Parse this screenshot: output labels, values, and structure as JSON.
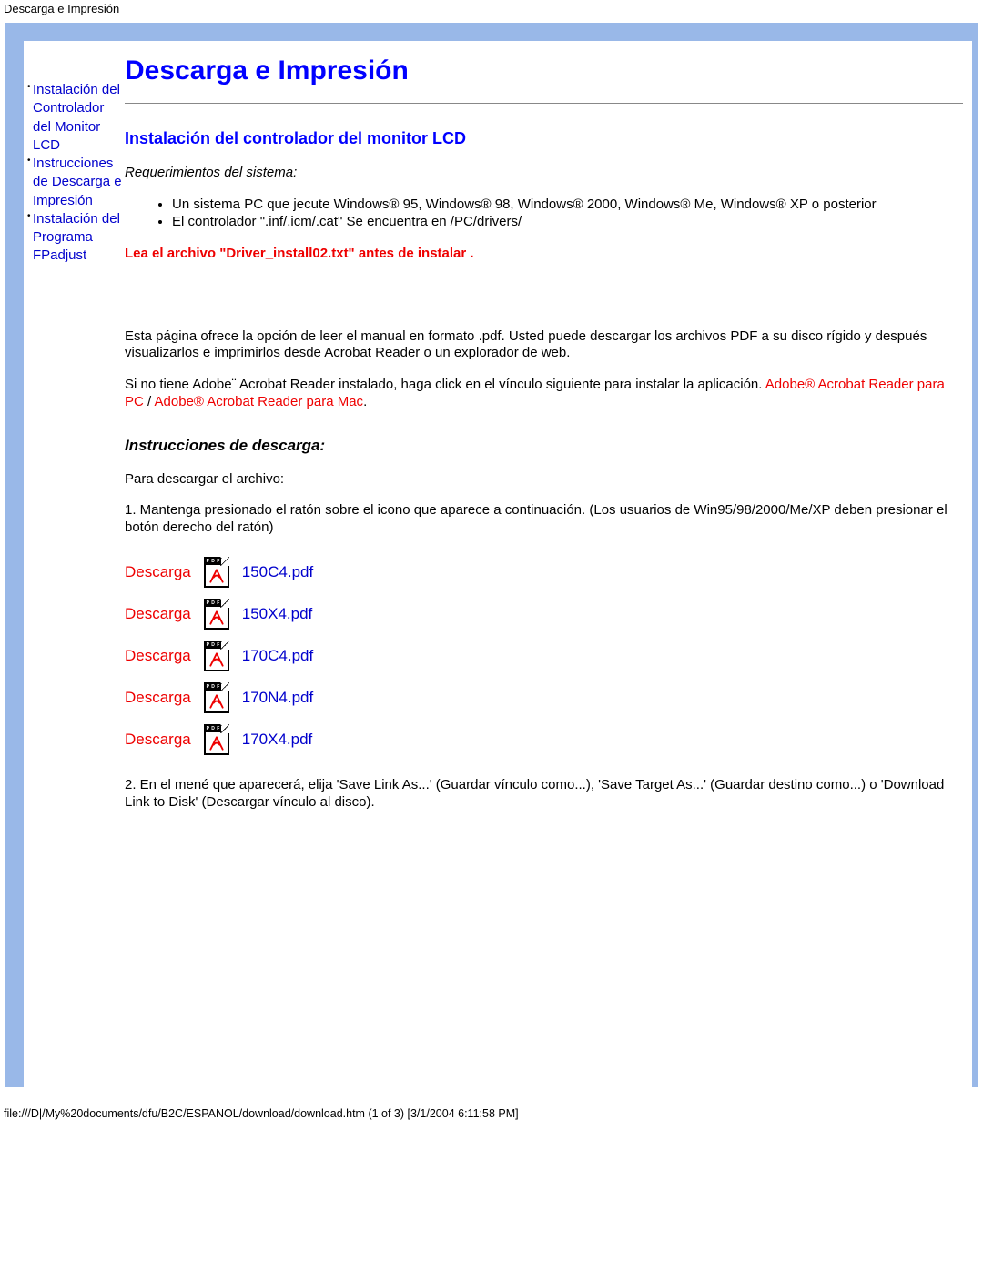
{
  "header": {
    "text": "Descarga e Impresión"
  },
  "sidebar": {
    "items": [
      {
        "label": "Instalación del Controlador del Monitor LCD"
      },
      {
        "label": "Instrucciones de Descarga e Impresión"
      },
      {
        "label": "Instalación del Programa FPadjust"
      }
    ]
  },
  "main": {
    "title": "Descarga e Impresión",
    "section1_title": "Instalación del controlador del monitor LCD",
    "sysreq_label": "Requerimientos del sistema:",
    "sysreq_items": [
      "Un sistema PC que jecute Windows® 95, Windows® 98, Windows® 2000, Windows® Me, Windows® XP o posterior",
      "El controlador \".inf/.icm/.cat\" Se encuentra en /PC/drivers/"
    ],
    "read_file_warning": "Lea el archivo \"Driver_install02.txt\" antes de instalar .",
    "intro_para": "Esta página ofrece la opción de leer el manual en formato .pdf. Usted puede descargar los archivos PDF a su disco rígido y después visualizarlos e imprimirlos desde Acrobat Reader o un explorador de web.",
    "adobe_prefix": "Si no tiene Adobe¨ Acrobat Reader instalado, haga click en el vínculo siguiente para instalar la aplicación. ",
    "adobe_pc": "Adobe® Acrobat Reader para PC",
    "adobe_sep": " / ",
    "adobe_mac": "Adobe® Acrobat Reader para Mac",
    "adobe_suffix": ".",
    "download_instr_title": "Instrucciones de descarga:",
    "download_intro": "Para descargar el archivo:",
    "step1": "1. Mantenga presionado el ratón sobre el icono que aparece a continuación. (Los usuarios de Win95/98/2000/Me/XP deben presionar el botón derecho del ratón)",
    "download_label": "Descarga",
    "downloads": [
      {
        "file": "150C4.pdf"
      },
      {
        "file": "150X4.pdf"
      },
      {
        "file": "170C4.pdf"
      },
      {
        "file": "170N4.pdf"
      },
      {
        "file": "170X4.pdf"
      }
    ],
    "step2": "2. En el mené que aparecerá, elija 'Save Link As...' (Guardar vínculo como...), 'Save Target As...' (Guardar destino como...) o 'Download Link to Disk' (Descargar vínculo al disco)."
  },
  "footer": {
    "path": "file:///D|/My%20documents/dfu/B2C/ESPANOL/download/download.htm (1 of 3) [3/1/2004 6:11:58 PM]"
  }
}
